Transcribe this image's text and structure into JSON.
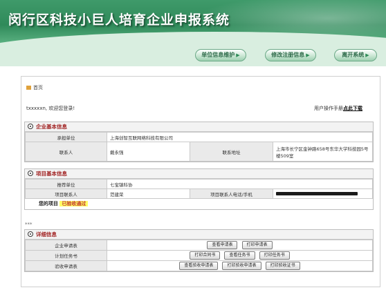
{
  "header": {
    "title": "闵行区科技小巨人培育企业申报系统"
  },
  "nav": {
    "unit_info": "单位信息维护",
    "change_reg": "修改注册信息",
    "exit": "离开系统",
    "arrow": "▶"
  },
  "breadcrumb": "首页",
  "welcome": "txxxxxn, 欢迎您登录!",
  "manual": {
    "prefix": "用户操作手册",
    "link": "点此下载"
  },
  "company": {
    "title": "企业基本信息",
    "declare_unit_label": "承担单位",
    "declare_unit_value": "上海创智互联网络科技有限公司",
    "contact_label": "联系人",
    "contact_value": "戴永强",
    "address_label": "联系地址",
    "address_value": "上海市长宁区金钟路658号东华大学科技园5号楼509室"
  },
  "project": {
    "title": "项目基本信息",
    "recommend_label": "推荐单位",
    "recommend_value": "七宝镇科协",
    "contact_label": "项目联系人",
    "contact_value": "范建荣",
    "phone_label": "项目联系人电话/手机",
    "status_prefix": "您的项目",
    "status_value": "已验收通过"
  },
  "dots": "***",
  "detail": {
    "title": "详细信息",
    "rows": [
      {
        "label": "企业申请表",
        "buttons": [
          "查看申请表",
          "打印申请表"
        ]
      },
      {
        "label": "计划任务书",
        "buttons": [
          "打印合同书",
          "查看任务书",
          "打印任务书"
        ]
      },
      {
        "label": "验收申请表",
        "buttons": [
          "查看验收申请表",
          "打印验收申请表",
          "打印验收证书"
        ]
      }
    ]
  }
}
